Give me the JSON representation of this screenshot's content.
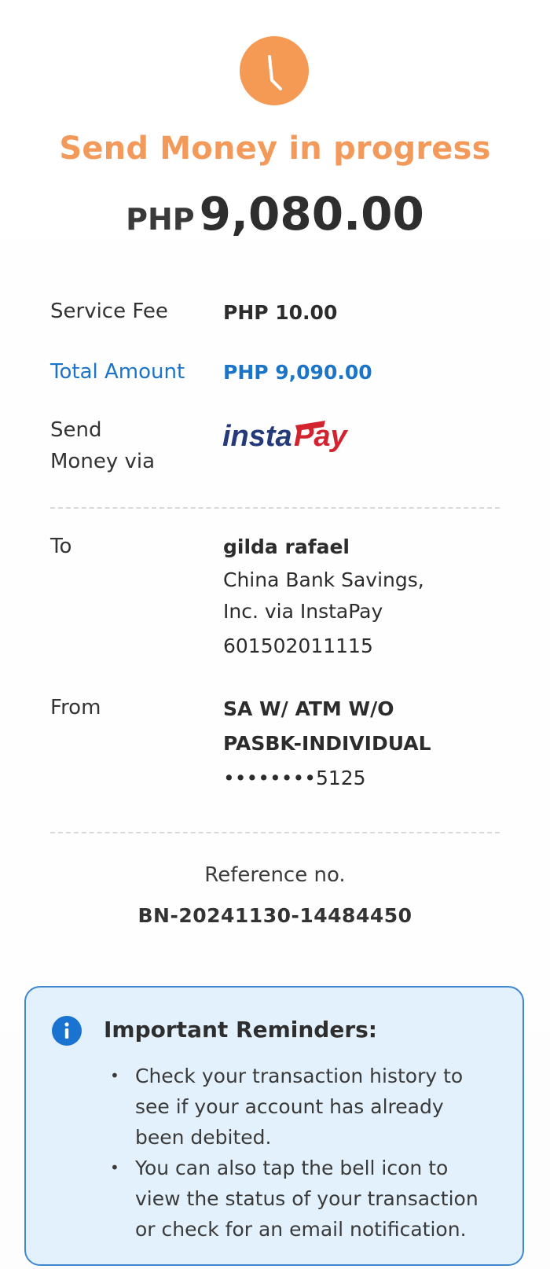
{
  "status": {
    "icon": "clock-icon",
    "title": "Send Money in progress",
    "color": "#f39a5b"
  },
  "amount": {
    "currency": "PHP",
    "value": "9,080.00"
  },
  "details": {
    "service_fee_label": "Service Fee",
    "service_fee_value": "PHP 10.00",
    "total_label": "Total Amount",
    "total_value": "PHP 9,090.00",
    "via_label_line1": "Send",
    "via_label_line2": "Money via",
    "via_logo": "instapay-logo"
  },
  "recipient": {
    "label": "To",
    "name": "gilda rafael",
    "bank_line1": "China Bank Savings,",
    "bank_line2": "Inc. via InstaPay",
    "account": "601502011115"
  },
  "sender": {
    "label": "From",
    "account_type_line1": "SA W/ ATM W/O",
    "account_type_line2": "PASBK-INDIVIDUAL",
    "account_masked": "••••••••5125"
  },
  "reference": {
    "label": "Reference no.",
    "value": "BN-20241130-14484450"
  },
  "reminders": {
    "icon": "info-icon",
    "title": "Important Reminders:",
    "items": [
      {
        "line1": "Check your transaction history to",
        "line2": "see if your account has already",
        "line3": "been debited."
      },
      {
        "line1": "You can also tap the bell icon to",
        "line2": "view the status of your transaction",
        "line3": "or check for an email notification."
      }
    ]
  },
  "colors": {
    "accent_orange": "#f59a55",
    "accent_blue": "#1b74c7",
    "reminder_bg": "#e3f1fc",
    "reminder_border": "#3f87cf"
  }
}
